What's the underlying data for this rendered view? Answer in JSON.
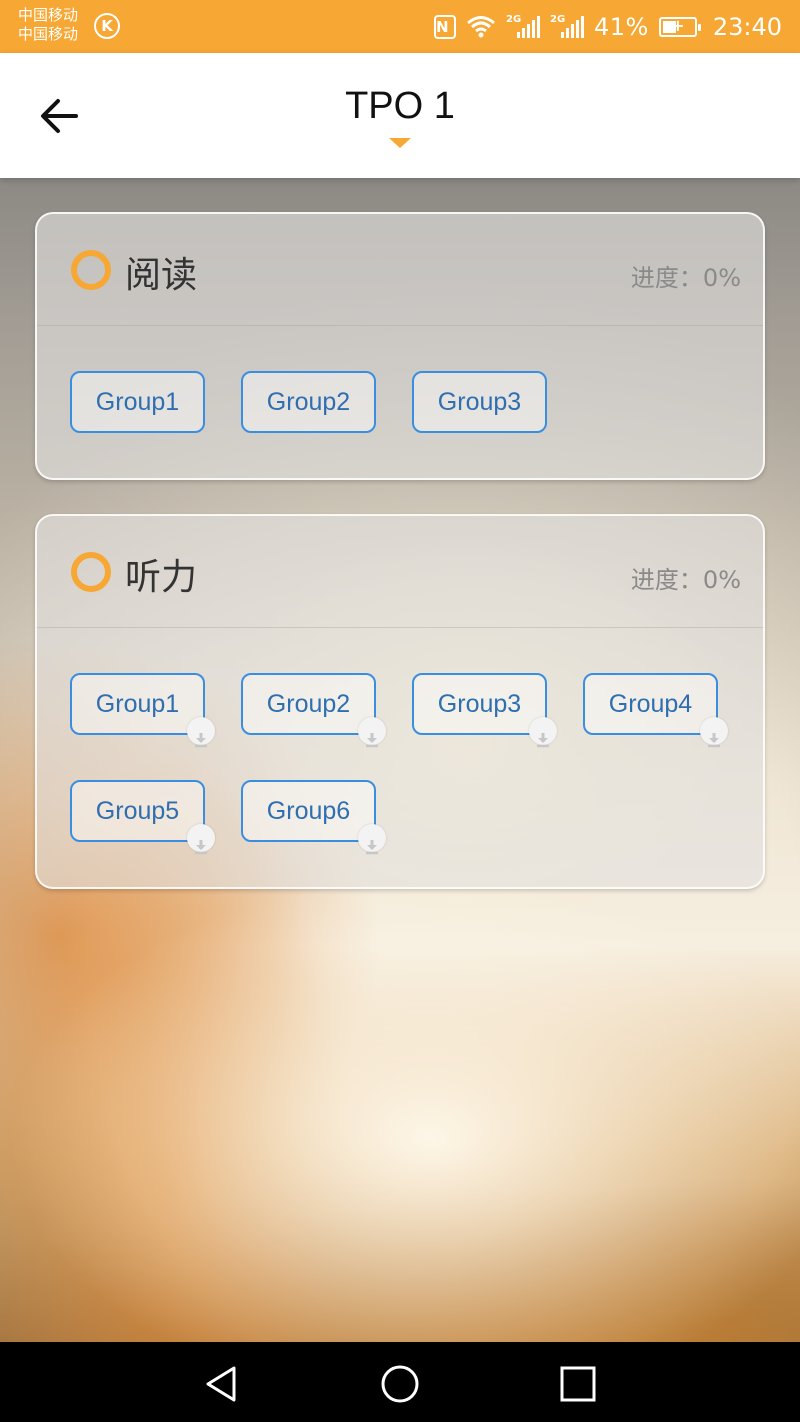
{
  "status_bar": {
    "carrier_1": "中国移动",
    "carrier_2": "中国移动",
    "carrier_badge": "K",
    "nfc_label": "N",
    "signal_tag_1": "2G",
    "signal_tag_2": "2G",
    "battery_percent": "41%",
    "time": "23:40",
    "icons": [
      "nfc-icon",
      "wifi-icon",
      "signal-icon",
      "signal-icon",
      "battery-charging-icon"
    ]
  },
  "header": {
    "back_icon": "arrow-left-icon",
    "title": "TPO 1",
    "title_dropdown_icon": "caret-down-icon"
  },
  "sections": [
    {
      "id": "reading",
      "title": "阅读",
      "progress_label": "进度：0%",
      "groups": [
        {
          "label": "Group1",
          "downloadable": false
        },
        {
          "label": "Group2",
          "downloadable": false
        },
        {
          "label": "Group3",
          "downloadable": false
        }
      ]
    },
    {
      "id": "listening",
      "title": "听力",
      "progress_label": "进度：0%",
      "groups": [
        {
          "label": "Group1",
          "downloadable": true
        },
        {
          "label": "Group2",
          "downloadable": true
        },
        {
          "label": "Group3",
          "downloadable": true
        },
        {
          "label": "Group4",
          "downloadable": true
        },
        {
          "label": "Group5",
          "downloadable": true
        },
        {
          "label": "Group6",
          "downloadable": true
        }
      ]
    }
  ],
  "colors": {
    "accent": "#f7a733",
    "group_border": "#3a8ee0",
    "group_text": "#2f6fb0"
  },
  "nav_bar": {
    "back": "triangle-back-icon",
    "home": "circle-home-icon",
    "recents": "square-recents-icon"
  }
}
